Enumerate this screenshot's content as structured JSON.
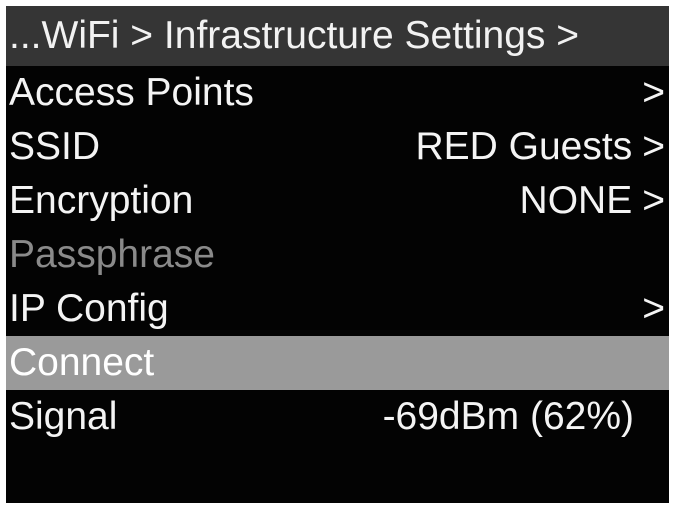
{
  "header": {
    "breadcrumb": "...WiFi > Infrastructure Settings >"
  },
  "menu": {
    "access_points": {
      "label": "Access Points",
      "chevron": ">"
    },
    "ssid": {
      "label": "SSID",
      "value": "RED Guests",
      "chevron": ">"
    },
    "encryption": {
      "label": "Encryption",
      "value": "NONE",
      "chevron": ">"
    },
    "passphrase": {
      "label": "Passphrase"
    },
    "ip_config": {
      "label": "IP Config",
      "chevron": ">"
    },
    "connect": {
      "label": "Connect"
    },
    "signal": {
      "label": "Signal",
      "value": "-69dBm (62%)"
    }
  },
  "colors": {
    "background": "#030303",
    "header_bg": "#353535",
    "selected_bg": "#9a9a9a",
    "text": "#f4f4f4",
    "disabled_text": "#8a8a8a"
  }
}
